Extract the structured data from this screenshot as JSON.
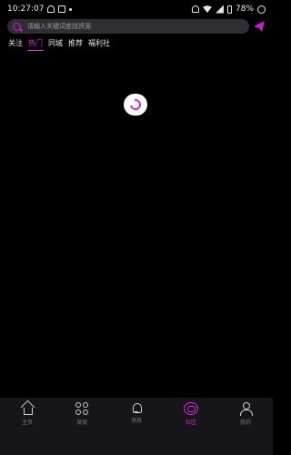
{
  "status_bar": {
    "time": "10:27:07",
    "battery": "78%"
  },
  "search": {
    "placeholder": "请输入关键词查找资源"
  },
  "tabs": [
    {
      "label": "关注"
    },
    {
      "label": "热门"
    },
    {
      "label": "同城"
    },
    {
      "label": "推荐"
    },
    {
      "label": "福利社"
    }
  ],
  "bottom_nav": [
    {
      "label": "主页",
      "icon": "home-icon"
    },
    {
      "label": "发现",
      "icon": "discover-icon"
    },
    {
      "label": "消息",
      "icon": "bell-icon"
    },
    {
      "label": "社区",
      "icon": "community-icon"
    },
    {
      "label": "我的",
      "icon": "profile-icon"
    }
  ],
  "colors": {
    "accent": "#e02ad6",
    "background": "#000000",
    "nav_bg": "#15151a",
    "search_bg": "#2f2f33"
  }
}
